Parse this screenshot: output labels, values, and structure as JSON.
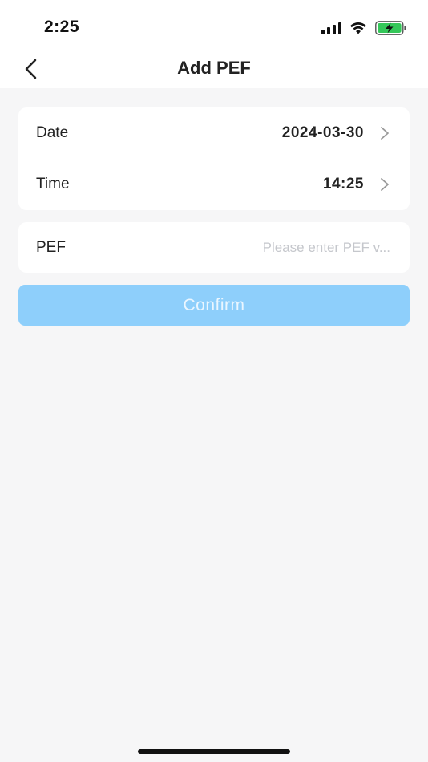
{
  "status_bar": {
    "time": "2:25",
    "signal_icon": "cellular-signal-icon",
    "wifi_icon": "wifi-icon",
    "battery_icon": "battery-charging-icon",
    "battery_color": "#34c759"
  },
  "nav": {
    "back_icon": "chevron-left-icon",
    "title": "Add PEF"
  },
  "form": {
    "date": {
      "label": "Date",
      "value": "2024-03-30",
      "chevron_icon": "chevron-right-icon"
    },
    "time": {
      "label": "Time",
      "value": "14:25",
      "chevron_icon": "chevron-right-icon"
    },
    "pef": {
      "label": "PEF",
      "value": "",
      "placeholder": "Please enter PEF v..."
    }
  },
  "confirm": {
    "label": "Confirm",
    "color": "#8ecffb"
  }
}
